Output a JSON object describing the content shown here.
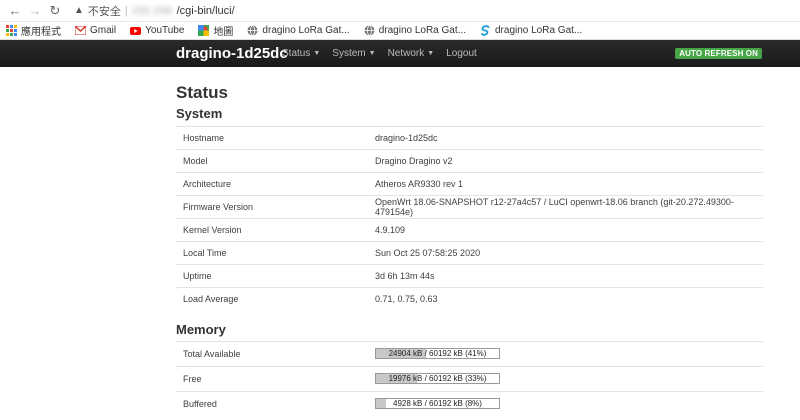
{
  "browser": {
    "secure_label": "不安全",
    "url_host": "192.168.",
    "url_path": "/cgi-bin/luci/"
  },
  "bookmarks": [
    {
      "label": "應用程式",
      "icon": "apps-icon"
    },
    {
      "label": "Gmail",
      "icon": "gmail-icon"
    },
    {
      "label": "YouTube",
      "icon": "youtube-icon"
    },
    {
      "label": "地圖",
      "icon": "maps-icon"
    },
    {
      "label": "dragino LoRa Gat...",
      "icon": "globe-icon"
    },
    {
      "label": "dragino LoRa Gat...",
      "icon": "globe-icon"
    },
    {
      "label": "dragino LoRa Gat...",
      "icon": "dragino-icon"
    }
  ],
  "header": {
    "brand": "dragino-1d25dc",
    "menu": [
      {
        "label": "Status",
        "dropdown": true
      },
      {
        "label": "System",
        "dropdown": true
      },
      {
        "label": "Network",
        "dropdown": true
      },
      {
        "label": "Logout",
        "dropdown": false
      }
    ],
    "auto_refresh": "AUTO REFRESH ON",
    "auto_refresh_color": "#46a546"
  },
  "page": {
    "title": "Status",
    "system_title": "System",
    "memory_title": "Memory"
  },
  "system": [
    {
      "key": "Hostname",
      "value": "dragino-1d25dc"
    },
    {
      "key": "Model",
      "value": "Dragino Dragino v2"
    },
    {
      "key": "Architecture",
      "value": "Atheros AR9330 rev 1"
    },
    {
      "key": "Firmware Version",
      "value": "OpenWrt 18.06-SNAPSHOT r12-27a4c57 / LuCI openwrt-18.06 branch (git-20.272.49300-479154e)"
    },
    {
      "key": "Kernel Version",
      "value": "4.9.109"
    },
    {
      "key": "Local Time",
      "value": "Sun Oct 25 07:58:25 2020"
    },
    {
      "key": "Uptime",
      "value": "3d 6h 13m 44s"
    },
    {
      "key": "Load Average",
      "value": "0.71, 0.75, 0.63"
    }
  ],
  "memory": [
    {
      "key": "Total Available",
      "text": "24904 kB / 60192 kB (41%)",
      "fraction": 0.41
    },
    {
      "key": "Free",
      "text": "19976 kB / 60192 kB (33%)",
      "fraction": 0.33
    },
    {
      "key": "Buffered",
      "text": "4928 kB / 60192 kB (8%)",
      "fraction": 0.08
    }
  ]
}
